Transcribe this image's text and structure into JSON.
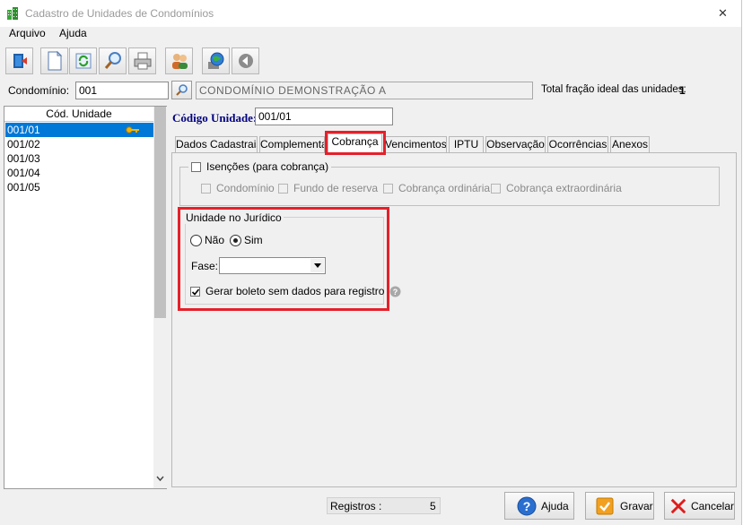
{
  "window": {
    "title": "Cadastro de Unidades de Condomínios",
    "close_glyph": "✕"
  },
  "menu": {
    "items": [
      "Arquivo",
      "Ajuda"
    ]
  },
  "toolbar": {
    "icons": [
      "exit-door-icon",
      "new-document-icon",
      "refresh-icon",
      "search-magnifier-icon",
      "print-icon",
      "people-icon",
      "globe-network-icon",
      "back-circle-icon"
    ]
  },
  "condominio": {
    "label": "Condomínio:",
    "code": "001",
    "name": "CONDOMÍNIO DEMONSTRAÇÃO A",
    "total_fraction_label": "Total fração ideal das unidades:",
    "total_fraction_value": "1"
  },
  "unit_list": {
    "header": "Cód. Unidade",
    "rows": [
      "001/01",
      "001/02",
      "001/03",
      "001/04",
      "001/05"
    ],
    "selected_index": 0
  },
  "codigo_unidade": {
    "label": "Código Unidade:",
    "value": "001/01"
  },
  "tabs": {
    "items": [
      "Dados Cadastrais",
      "Complementar",
      "Cobrança",
      "Vencimentos",
      "IPTU",
      "Observação",
      "Ocorrências",
      "Anexos"
    ],
    "active": "Cobrança"
  },
  "isencoes": {
    "label": "Isenções (para cobrança)",
    "checked": false,
    "options": [
      "Condomínio",
      "Fundo de reserva",
      "Cobrança ordinária",
      "Cobrança extraordinária"
    ]
  },
  "juridico": {
    "title": "Unidade no Jurídico",
    "options": [
      "Não",
      "Sim"
    ],
    "selected": "Sim",
    "fase_label": "Fase:",
    "fase_value": "",
    "gerar_boleto_label": "Gerar boleto sem dados para registro",
    "gerar_boleto_checked": true
  },
  "status": {
    "registros_label": "Registros :",
    "registros_value": "5"
  },
  "buttons": {
    "ajuda": "Ajuda",
    "gravar": "Gravar",
    "cancelar": "Cancelar"
  },
  "colors": {
    "highlight_red": "#e5202a",
    "selection_blue": "#0078d7",
    "label_navy": "#000080"
  }
}
